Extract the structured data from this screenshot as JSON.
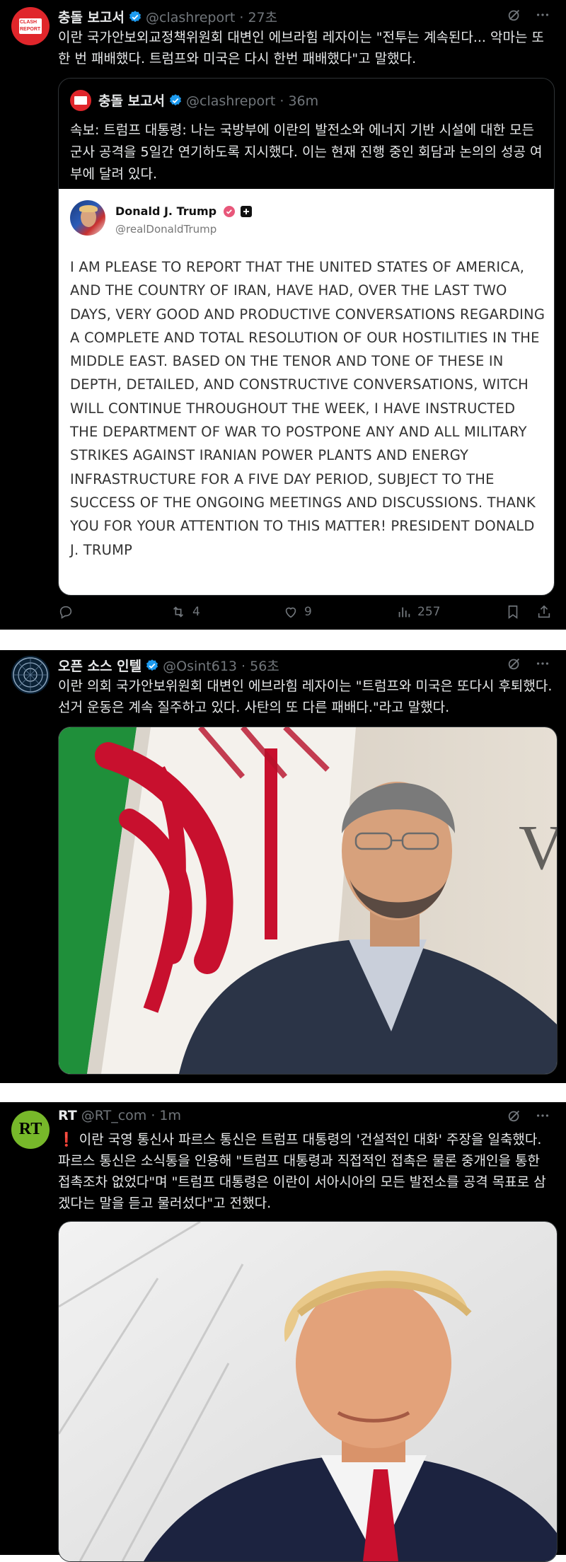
{
  "posts": [
    {
      "author_name": "충돌 보고서",
      "handle_time": "@clashreport · 27초",
      "avatar_text": [
        "CLASH",
        "REPORT"
      ],
      "text": "이란 국가안보외교정책위원회 대변인 에브라힘 레자이는 \"전투는 계속된다... 악마는 또 한 번 패배했다. 트럼프와 미국은 다시 한번 패배했다\"고 말했다.",
      "quote": {
        "author_name": "충돌 보고서",
        "handle_time": "@clashreport · 36m",
        "text": "속보: 트럼프 대통령: 나는 국방부에 이란의 발전소와 에너지 기반 시설에 대한 모든 군사 공격을 5일간 연기하도록 지시했다. 이는 현재 진행 중인 회담과 논의의 성공 여부에 달려 있다.",
        "truth": {
          "name": "Donald J. Trump",
          "handle": "@realDonaldTrump",
          "text": "I AM PLEASE TO REPORT THAT THE UNITED STATES OF AMERICA, AND THE COUNTRY OF IRAN, HAVE HAD, OVER THE LAST TWO DAYS, VERY GOOD AND PRODUCTIVE CONVERSATIONS REGARDING A COMPLETE AND TOTAL RESOLUTION OF OUR HOSTILITIES IN THE MIDDLE EAST. BASED ON THE TENOR AND TONE OF THESE IN DEPTH, DETAILED, AND CONSTRUCTIVE CONVERSATIONS, WITCH WILL CONTINUE THROUGHOUT THE WEEK, I HAVE INSTRUCTED THE DEPARTMENT OF WAR TO POSTPONE ANY AND ALL MILITARY STRIKES AGAINST IRANIAN POWER PLANTS AND ENERGY INFRASTRUCTURE FOR A FIVE DAY PERIOD, SUBJECT TO THE SUCCESS OF THE ONGOING MEETINGS AND DISCUSSIONS. THANK YOU FOR YOUR ATTENTION TO THIS MATTER! PRESIDENT DONALD J. TRUMP"
        }
      },
      "actions": {
        "reposts": "4",
        "likes": "9",
        "views": "257"
      }
    },
    {
      "author_name": "오픈 소스 인텔",
      "handle_time": "@Osint613 · 56초",
      "text": "이란 의회 국가안보위원회 대변인 에브라힘 레자이는 \"트럼프와 미국은 또다시 후퇴했다. 선거 운동은 계속 질주하고 있다. 사탄의 또 다른 패배다.\"라고 말했다."
    },
    {
      "author_name": "RT",
      "handle_time": "@RT_com · 1m",
      "avatar_text": "RT",
      "text_prefix": "❗",
      "text": " 이란 국영 통신사 파르스 통신은 트럼프 대통령의 '건설적인 대화' 주장을 일축했다. 파르스 통신은 소식통을 인용해 \"트럼프 대통령과 직접적인 접촉은 물론 중개인을 통한 접촉조차 없었다\"며 \"트럼프 대통령은 이란이 서아시아의 모든 발전소를 공격 목표로 삼겠다는 말을 듣고 물러섰다\"고 전했다."
    }
  ],
  "icons": [
    "grok-icon",
    "more-icon",
    "reply-icon",
    "repost-icon",
    "like-icon",
    "views-icon",
    "bookmark-icon",
    "share-icon",
    "verified-badge-icon"
  ],
  "colors": {
    "background": "#000000",
    "verified": "#1d9bf0",
    "muted": "#71767b",
    "rt_green": "#77b82a",
    "clash_red": "#e0262b"
  }
}
